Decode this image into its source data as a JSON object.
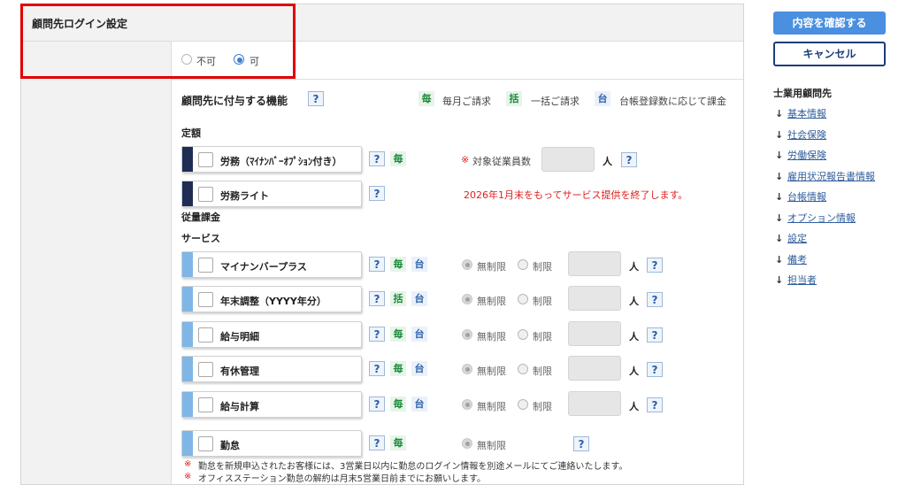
{
  "section_title": "顧問先ログイン設定",
  "login_radio": {
    "options": [
      "不可",
      "可"
    ],
    "selected": "可"
  },
  "features": {
    "title": "顧問先に付与する機能",
    "legend": [
      {
        "badge": "毎",
        "text": "毎月ご請求"
      },
      {
        "badge": "括",
        "text": "一括ご請求"
      },
      {
        "badge": "台",
        "text": "台帳登録数に応じて課金"
      }
    ],
    "help": "?"
  },
  "groups": {
    "fixed": "定額",
    "metered": "従量課金",
    "service": "サービス"
  },
  "fixed_items": [
    {
      "label": "労務（ﾏｲﾅﾝﾊﾞｰｵﾌﾟｼｮﾝ付き）",
      "badges": [
        "毎"
      ]
    },
    {
      "label": "労務ライト",
      "badges": []
    }
  ],
  "employee_count": {
    "mark": "※",
    "label": "対象従業員数",
    "unit": "人"
  },
  "end_notice": "2026年1月末をもってサービス提供を終了します。",
  "service_items": [
    {
      "label": "マイナンバープラス",
      "badges": [
        "毎",
        "台"
      ],
      "unit": "人"
    },
    {
      "label": "年末調整（YYYY年分）",
      "badges": [
        "括",
        "台"
      ],
      "unit": "人"
    },
    {
      "label": "給与明細",
      "badges": [
        "毎",
        "台"
      ],
      "unit": "人"
    },
    {
      "label": "有休管理",
      "badges": [
        "毎",
        "台"
      ],
      "unit": "人"
    },
    {
      "label": "給与計算",
      "badges": [
        "毎",
        "台"
      ],
      "unit": "人"
    },
    {
      "label": "勤怠",
      "badges": [
        "毎"
      ],
      "unit": ""
    }
  ],
  "limit_options": {
    "unlimited": "無制限",
    "limited": "制限"
  },
  "notes": [
    {
      "mark": "※",
      "text": "勤怠を新規申込されたお客様には、3営業日以内に勤怠のログイン情報を別途メールにてご連絡いたします。"
    },
    {
      "mark": "※",
      "text": "オフィスステーション勤怠の解約は月末5営業日前までにお願いします。"
    }
  ],
  "buttons": {
    "confirm": "内容を確認する",
    "cancel": "キャンセル"
  },
  "nav": {
    "heading": "士業用顧問先",
    "arrow": "↓",
    "items": [
      "基本情報",
      "社会保険",
      "労働保険",
      "雇用状況報告書情報",
      "台帳情報",
      "オプション情報",
      "設定",
      "備考",
      "担当者"
    ]
  },
  "colors": {
    "accent_blue": "#4a8fe0",
    "navy": "#1d3d7a",
    "stripe_dark": "#1f2d55",
    "stripe_light": "#7fb6e6",
    "badge_green": "#1b8a3a",
    "highlight_red": "#e00000"
  }
}
